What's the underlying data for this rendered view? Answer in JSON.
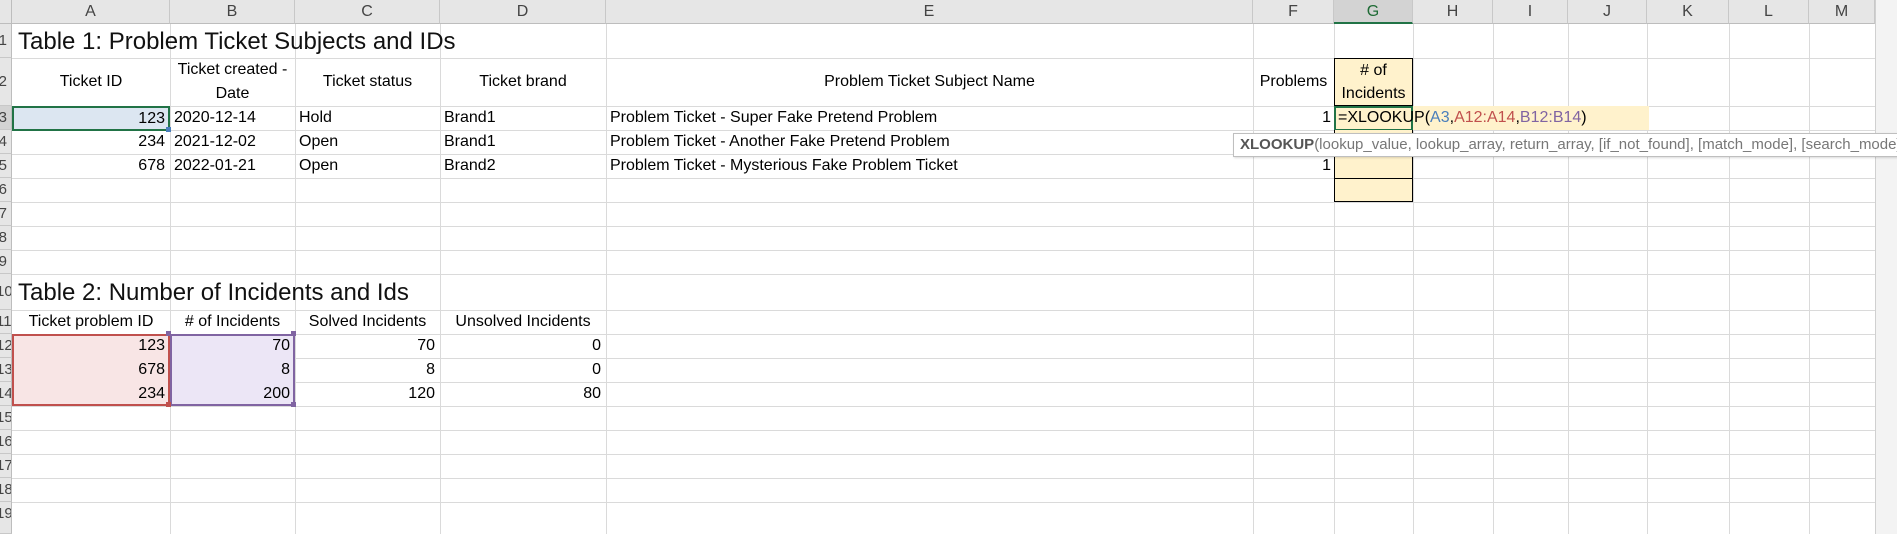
{
  "columns": [
    "A",
    "B",
    "C",
    "D",
    "E",
    "F",
    "G",
    "H",
    "I",
    "J",
    "K",
    "L",
    "M"
  ],
  "rows": [
    "1",
    "2",
    "3",
    "4",
    "5",
    "6",
    "7",
    "8",
    "9",
    "10",
    "11",
    "12",
    "13",
    "14",
    "15",
    "16",
    "17",
    "18",
    "19"
  ],
  "table1": {
    "title": "Table 1: Problem Ticket Subjects and IDs",
    "headers": {
      "ticket_id": "Ticket ID",
      "created_line1": "Ticket created -",
      "created_line2": "Date",
      "status": "Ticket status",
      "brand": "Ticket brand",
      "subject": "Problem Ticket Subject Name",
      "problems": "Problems",
      "incidents_line1": "# of",
      "incidents_line2": "Incidents"
    },
    "rows": [
      {
        "id": "123",
        "date": "2020-12-14",
        "status": "Hold",
        "brand": "Brand1",
        "subject": "Problem Ticket - Super Fake Pretend Problem",
        "problems": "1"
      },
      {
        "id": "234",
        "date": "2021-12-02",
        "status": "Open",
        "brand": "Brand1",
        "subject": "Problem Ticket - Another Fake Pretend Problem",
        "problems": ""
      },
      {
        "id": "678",
        "date": "2022-01-21",
        "status": "Open",
        "brand": "Brand2",
        "subject": "Problem Ticket - Mysterious Fake Problem Ticket",
        "problems": "1"
      }
    ]
  },
  "formula": {
    "prefix": "=XLOOKUP(",
    "arg1": "A3",
    "sep1": ",",
    "arg2": "A12:A14",
    "sep2": ",",
    "arg3": "B12:B14",
    "suffix": ")"
  },
  "tooltip": {
    "fn": "XLOOKUP",
    "args": "(lookup_value, lookup_array, return_array, [if_not_found], [match_mode], [search_mode])"
  },
  "table2": {
    "title": "Table 2: Number of Incidents and Ids",
    "headers": {
      "problem_id": "Ticket problem ID",
      "incidents": "# of Incidents",
      "solved": "Solved Incidents",
      "unsolved": "Unsolved Incidents"
    },
    "rows": [
      {
        "id": "123",
        "incidents": "70",
        "solved": "70",
        "unsolved": "0"
      },
      {
        "id": "678",
        "incidents": "8",
        "solved": "8",
        "unsolved": "0"
      },
      {
        "id": "234",
        "incidents": "200",
        "solved": "120",
        "unsolved": "80"
      }
    ]
  },
  "colors": {
    "formula_arg1": "#4a7ebb",
    "formula_arg2": "#c0504d",
    "formula_arg3": "#8064a2",
    "active_cell_fill": "#fff2cc",
    "selection_green": "#217346"
  }
}
